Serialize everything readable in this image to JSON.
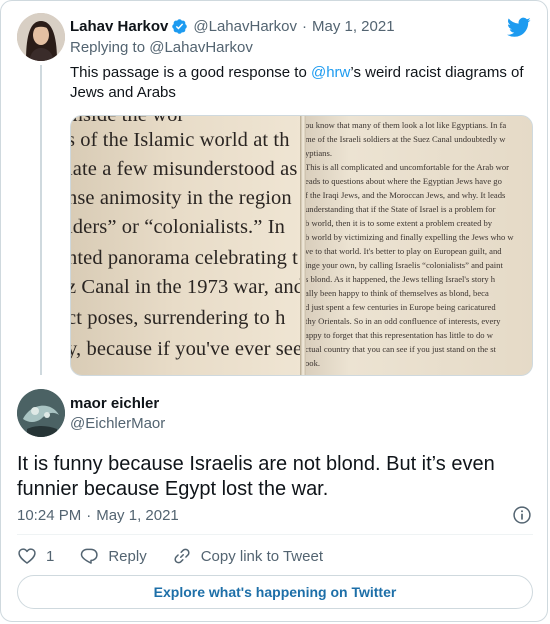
{
  "parent_tweet": {
    "author_name": "Lahav Harkov",
    "handle": "@LahavHarkov",
    "separator": "·",
    "date": "May 1, 2021",
    "replying_to_prefix": "Replying to",
    "replying_to_handle": "@LahavHarkov",
    "text_before": "This passage is a good response to ",
    "mention": "@hrw",
    "text_after": "’s weird racist diagrams of Jews and Arabs",
    "photo": {
      "left_page_lines": [
        "ιnside the wor",
        "s of the Islamic world at th",
        "iate a few misunderstood as",
        "nse animosity in the region",
        "iders” or “colonialists.” In",
        "nted panorama celebrating t",
        "z Canal in the 1973 war, and",
        "ct poses, surrendering to h",
        "y, because if you've ever seen"
      ],
      "right_page_lines": [
        "ou know that many of them look a lot like Egyptians. In fa",
        "me of the Israeli soldiers at the Suez Canal undoubtedly w",
        "yptians.",
        "This is all complicated and uncomfortable for the Arab wor",
        "eads to questions about where the Egyptian Jews have go",
        "f the Iraqi Jews, and the Moroccan Jews, and why. It leads",
        "understanding that if the State of Israel is a problem for",
        "b world, then it is to some extent a problem created by",
        "b world by victimizing and finally expelling the Jews who w",
        "ve to that world. It's better to play on European guilt, and",
        "inge your own, by calling Israelis “colonialists” and paint",
        "s blond. As it happened, the Jews telling Israel's story h",
        "ally been happy to think of themselves as blond, beca",
        "d just spent a few centuries in Europe being caricatured",
        "thy Orientals. So in an odd confluence of interests, every",
        "appy to forget that this representation has little to do w",
        "ctual country that you can see if you just stand on the st",
        "ook."
      ]
    }
  },
  "main_tweet": {
    "author_name": "maor eichler",
    "handle": "@EichlerMaor",
    "text": "It is funny because Israelis are not blond. But it’s even funnier because Egypt lost the war.",
    "time": "10:24 PM",
    "separator": "·",
    "date": "May 1, 2021"
  },
  "actions": {
    "like_count": "1",
    "reply_label": "Reply",
    "copy_link_label": "Copy link to Tweet"
  },
  "explore_label": "Explore what's happening on Twitter",
  "colors": {
    "accent": "#1d9bf0",
    "text": "#0f1419",
    "muted": "#536471",
    "border": "#cfd9de"
  }
}
